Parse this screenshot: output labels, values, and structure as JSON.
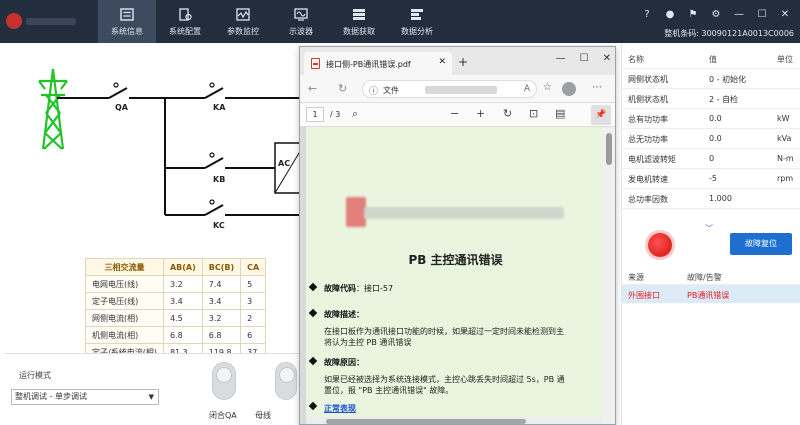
{
  "nav": {
    "tabs": [
      {
        "label": "系统信息",
        "icon": "info-board-icon"
      },
      {
        "label": "系统配置",
        "icon": "config-icon"
      },
      {
        "label": "参数监控",
        "icon": "monitor-icon"
      },
      {
        "label": "示波器",
        "icon": "oscilloscope-icon"
      },
      {
        "label": "数据获取",
        "icon": "data-fetch-icon"
      },
      {
        "label": "数据分析",
        "icon": "data-analysis-icon"
      }
    ],
    "active_index": 0,
    "serial_label": "整机条码: 30090121A0013C0006",
    "window_icons": [
      "help-icon",
      "user-icon",
      "flag-icon",
      "settings-icon",
      "minimize-icon",
      "maximize-icon",
      "close-icon"
    ]
  },
  "schematic": {
    "switches": {
      "qa": "QA",
      "ka": "KA",
      "kb": "KB",
      "kc": "KC"
    },
    "converter": "AC"
  },
  "acq_table": {
    "headers": [
      "三相交流量",
      "AB(A)",
      "BC(B)",
      "CA"
    ],
    "rows": [
      {
        "label": "电网电压(线)",
        "ab": "3.2",
        "bc": "7.4",
        "ca": "5"
      },
      {
        "label": "定子电压(线)",
        "ab": "3.4",
        "bc": "3.4",
        "ca": "3"
      },
      {
        "label": "网侧电流(相)",
        "ab": "4.5",
        "bc": "3.2",
        "ca": "2"
      },
      {
        "label": "机侧电流(相)",
        "ab": "6.8",
        "bc": "6.8",
        "ca": "6"
      },
      {
        "label": "定子/系统电流(相)",
        "ab": "81.3",
        "bc": "119.8",
        "ca": "37"
      }
    ]
  },
  "controls": {
    "mode_label": "运行模式",
    "mode_value": "整机调试 - 单步调试",
    "toggles": [
      {
        "label": "闭合QA"
      },
      {
        "label": "母线"
      }
    ]
  },
  "status_table": {
    "headers": [
      "名称",
      "值",
      "单位"
    ],
    "rows": [
      {
        "name": "网侧状态机",
        "value": "0 - 初始化",
        "unit": ""
      },
      {
        "name": "机侧状态机",
        "value": "2 - 自检",
        "unit": ""
      },
      {
        "name": "总有功功率",
        "value": "0.0",
        "unit": "kW"
      },
      {
        "name": "总无功功率",
        "value": "0.0",
        "unit": "kVa"
      },
      {
        "name": "电机滤波转矩",
        "value": "0",
        "unit": "N-m"
      },
      {
        "name": "发电机转速",
        "value": "-5",
        "unit": "rpm"
      },
      {
        "name": "总功率因数",
        "value": "1.000",
        "unit": ""
      }
    ]
  },
  "faults": {
    "reset_label": "故障复位",
    "indicator_color": "#e0201a",
    "headers": [
      "来源",
      "故障/告警"
    ],
    "rows": [
      {
        "source": "外围接口",
        "fault": "PB通讯错误"
      }
    ]
  },
  "pdf": {
    "tab_title": "接口侧-PB通讯错误.pdf",
    "url_prefix": "文件",
    "page_current": "1",
    "page_total": "/ 3",
    "doc_title": "PB 主控通讯错误",
    "fault_code_label": "故障代码",
    "fault_code_value": "：接口-57",
    "desc_label": "故障描述",
    "desc_text_1": "在接口板作为通讯接口功能的时候，如果超过一定时间未能检测到主",
    "desc_text_2": "将认为主控 PB 通讯错误",
    "cause_label": "故障原因",
    "cause_text_1": "如果已经被选择为系统连接模式，主控心跳丢失时间超过 5s，PB 通",
    "cause_text_2": "置位，报 \"PB 主控通讯错误\" 故障。",
    "link_text": "正常表现"
  }
}
